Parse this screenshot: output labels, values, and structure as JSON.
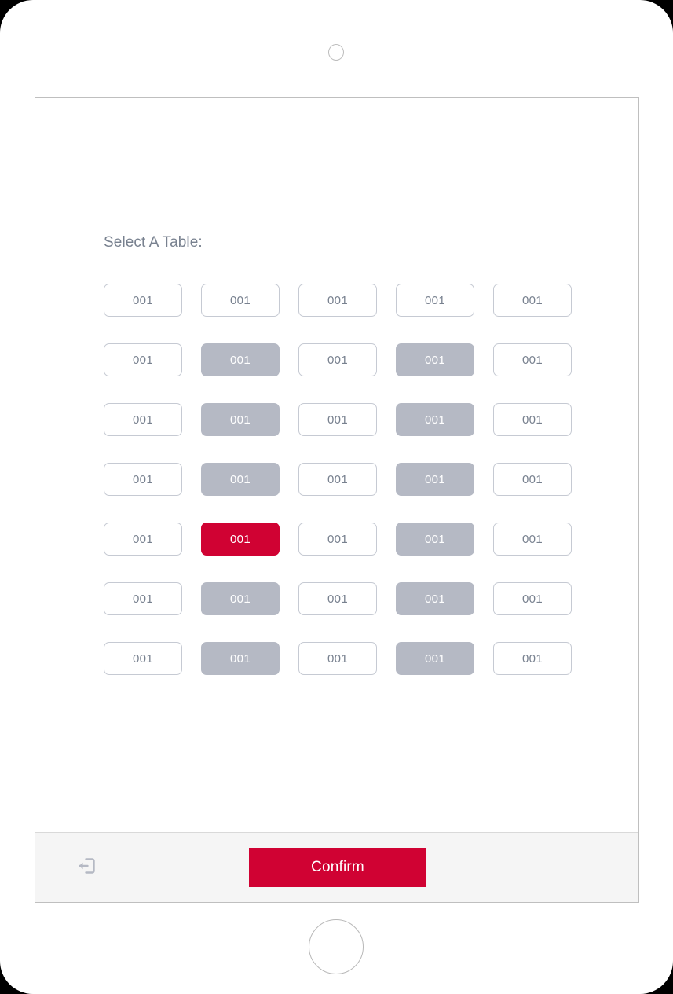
{
  "device": {
    "type": "tablet",
    "camera_icon": "camera-dot-icon",
    "home_button_icon": "home-button-icon"
  },
  "screen": {
    "heading": "Select A Table:"
  },
  "table_grid": {
    "columns": 5,
    "rows": 7,
    "states_legend": {
      "free": "available",
      "occupied": "occupied",
      "selected": "selected"
    },
    "buttons": [
      {
        "label": "001",
        "state": "free"
      },
      {
        "label": "001",
        "state": "free"
      },
      {
        "label": "001",
        "state": "free"
      },
      {
        "label": "001",
        "state": "free"
      },
      {
        "label": "001",
        "state": "free"
      },
      {
        "label": "001",
        "state": "free"
      },
      {
        "label": "001",
        "state": "occupied"
      },
      {
        "label": "001",
        "state": "free"
      },
      {
        "label": "001",
        "state": "occupied"
      },
      {
        "label": "001",
        "state": "free"
      },
      {
        "label": "001",
        "state": "free"
      },
      {
        "label": "001",
        "state": "occupied"
      },
      {
        "label": "001",
        "state": "free"
      },
      {
        "label": "001",
        "state": "occupied"
      },
      {
        "label": "001",
        "state": "free"
      },
      {
        "label": "001",
        "state": "free"
      },
      {
        "label": "001",
        "state": "occupied"
      },
      {
        "label": "001",
        "state": "free"
      },
      {
        "label": "001",
        "state": "occupied"
      },
      {
        "label": "001",
        "state": "free"
      },
      {
        "label": "001",
        "state": "free"
      },
      {
        "label": "001",
        "state": "selected"
      },
      {
        "label": "001",
        "state": "free"
      },
      {
        "label": "001",
        "state": "occupied"
      },
      {
        "label": "001",
        "state": "free"
      },
      {
        "label": "001",
        "state": "free"
      },
      {
        "label": "001",
        "state": "occupied"
      },
      {
        "label": "001",
        "state": "free"
      },
      {
        "label": "001",
        "state": "occupied"
      },
      {
        "label": "001",
        "state": "free"
      },
      {
        "label": "001",
        "state": "free"
      },
      {
        "label": "001",
        "state": "occupied"
      },
      {
        "label": "001",
        "state": "free"
      },
      {
        "label": "001",
        "state": "occupied"
      },
      {
        "label": "001",
        "state": "free"
      }
    ]
  },
  "footer": {
    "logout_icon": "logout-icon",
    "confirm_label": "Confirm"
  },
  "colors": {
    "accent_red": "#d00233",
    "occupied_gray": "#b5b9c4",
    "border_gray": "#c6cad3",
    "text_gray": "#78818f",
    "footer_bg": "#f5f5f5",
    "panel_border": "#bfbfbf"
  }
}
